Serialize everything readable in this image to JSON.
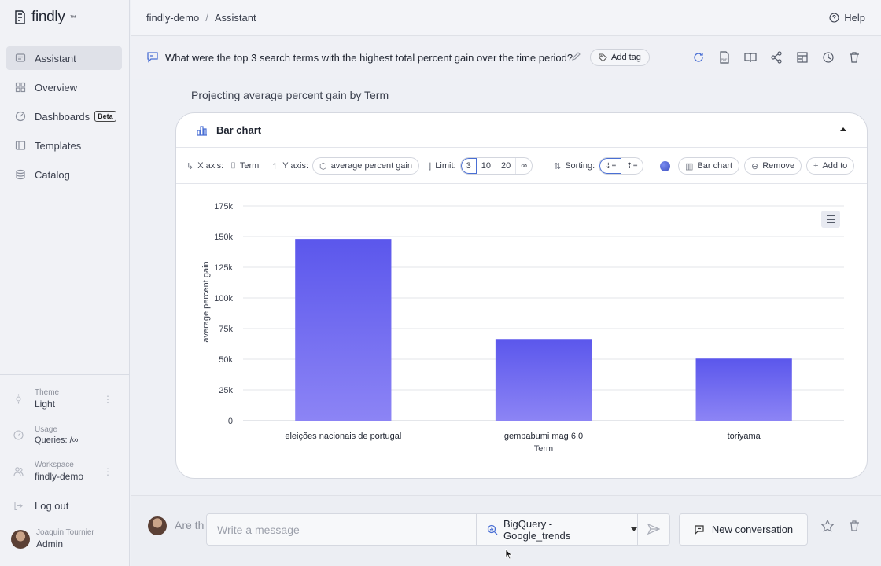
{
  "app": {
    "brand": "findly",
    "trademark": "™"
  },
  "sidebar": {
    "items": [
      {
        "label": "Assistant",
        "icon": "chat-icon",
        "active": true
      },
      {
        "label": "Overview",
        "icon": "grid-icon"
      },
      {
        "label": "Dashboards",
        "icon": "dashboard-icon",
        "badge": "Beta"
      },
      {
        "label": "Templates",
        "icon": "template-icon"
      },
      {
        "label": "Catalog",
        "icon": "database-icon"
      }
    ],
    "theme": {
      "label": "Theme",
      "value": "Light"
    },
    "usage": {
      "label": "Usage",
      "value": "Queries: /∞"
    },
    "workspace": {
      "label": "Workspace",
      "value": "findly-demo"
    },
    "logout": "Log out",
    "user": {
      "name": "Joaquin Tournier",
      "role": "Admin"
    }
  },
  "topbar": {
    "breadcrumb": [
      "findly-demo",
      "Assistant"
    ],
    "breadcrumb_sep": "/",
    "help": "Help"
  },
  "question": {
    "text": "What were the top 3 search terms with the highest total percent gain over the time period?",
    "add_tag": "Add tag"
  },
  "main": {
    "title": "Projecting average percent gain by Term",
    "card_title": "Bar chart",
    "controls": {
      "x_axis_label": "X axis:",
      "x_axis_value": "Term",
      "y_axis_label": "Y axis:",
      "y_axis_value": "average percent gain",
      "limit_label": "Limit:",
      "limit_options": [
        "3",
        "10",
        "20",
        "∞"
      ],
      "limit_selected": "3",
      "sorting_label": "Sorting:",
      "chart_type": "Bar chart",
      "remove": "Remove",
      "add_to": "Add to"
    }
  },
  "chart_data": {
    "type": "bar",
    "categories": [
      "eleições nacionais de portugal",
      "gempabumi mag 6.0",
      "toriyama"
    ],
    "values": [
      148000,
      66500,
      50500
    ],
    "xlabel": "Term",
    "ylabel": "average percent gain",
    "ylim": [
      0,
      175000
    ],
    "yticks": [
      0,
      25000,
      50000,
      75000,
      100000,
      125000,
      150000,
      175000
    ],
    "ytick_labels": [
      "0",
      "25k",
      "50k",
      "75k",
      "100k",
      "125k",
      "150k",
      "175k"
    ],
    "grid": true,
    "bar_color_top": "#5b57ec",
    "bar_color_bottom": "#8c84f5"
  },
  "chat": {
    "ghost_text": "Are th",
    "placeholder": "Write a message",
    "source": "BigQuery - Google_trends",
    "new_conversation": "New conversation"
  },
  "colors": {
    "accent": "#4a6fd4",
    "background": "#eef0f5"
  }
}
